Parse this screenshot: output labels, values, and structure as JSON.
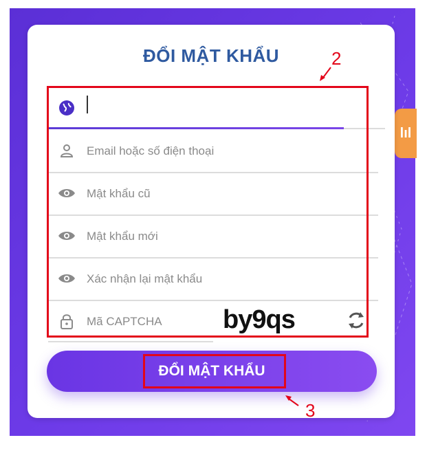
{
  "card": {
    "title": "ĐỔI MẬT KHẨU"
  },
  "form": {
    "country_value": "",
    "email_placeholder": "Email hoặc số điện thoại",
    "old_password_placeholder": "Mật khẩu cũ",
    "new_password_placeholder": "Mật khẩu mới",
    "confirm_password_placeholder": "Xác nhận lại mật khẩu",
    "captcha_placeholder": "Mã CAPTCHA",
    "captcha_text": "by9qs"
  },
  "submit": {
    "label": "ĐỔI MẬT KHẨU"
  },
  "annotations": {
    "form_box_number": "2",
    "button_box_number": "3"
  },
  "icons": {
    "country": "globe-icon",
    "email": "user-icon",
    "password": "eye-icon",
    "captcha": "lock-icon",
    "refresh": "refresh-icon"
  },
  "colors": {
    "background": "#6b39e6",
    "title": "#2f5aa0",
    "highlight": "#e3061a",
    "button": "#7a45ea"
  }
}
